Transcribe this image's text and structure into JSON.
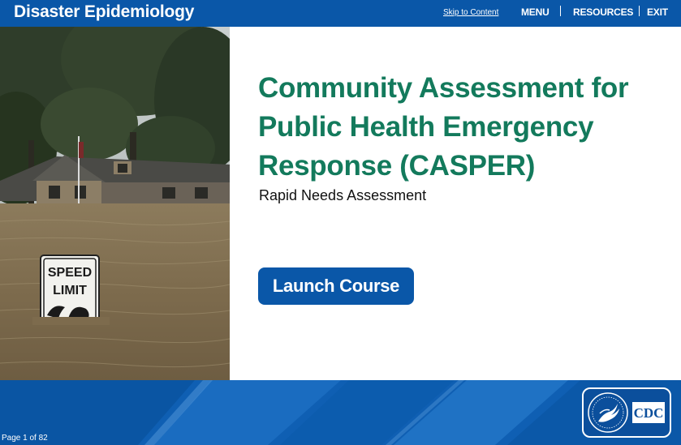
{
  "header": {
    "app_title": "Disaster Epidemiology",
    "skip_link": "Skip to Content",
    "nav": {
      "menu": "MENU",
      "resources": "RESOURCES",
      "exit": "EXIT"
    }
  },
  "hero": {
    "image": "flooded-house-speed-limit-photo",
    "sign_line1": "SPEED",
    "sign_line2": "LIMIT"
  },
  "content": {
    "title": "Community Assessment for Public Health Emergency Response (CASPER)",
    "subtitle": "Rapid Needs Assessment",
    "launch_button": "Launch Course"
  },
  "footer": {
    "page_indicator": "Page 1 of 82",
    "logo": "hhs-cdc-logo",
    "logo_text": "CDC"
  },
  "colors": {
    "header_blue": "#0a57a8",
    "title_green": "#137a5c",
    "footer_blue": "#0f5fb3"
  }
}
